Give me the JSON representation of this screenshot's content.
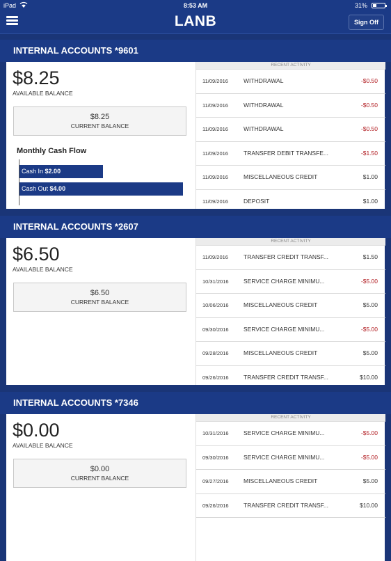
{
  "status": {
    "carrier": "iPad",
    "time": "8:53 AM",
    "battery": "31%"
  },
  "nav": {
    "title": "LANB",
    "sign_off": "Sign Off"
  },
  "recent_activity_label": "RECENT ACTIVITY",
  "accounts": [
    {
      "header": "INTERNAL ACCOUNTS *9601",
      "available_amount": "$8.25",
      "available_label": "AVAILABLE BALANCE",
      "current_amount": "$8.25",
      "current_label": "CURRENT BALANCE",
      "cash_flow": {
        "title": "Monthly Cash Flow",
        "cash_in_label": "Cash In",
        "cash_in_value": "$2.00",
        "cash_out_label": "Cash Out",
        "cash_out_value": "$4.00"
      },
      "transactions": [
        {
          "date": "11/09/2016",
          "desc": "WITHDRAWAL",
          "amount": "-$0.50"
        },
        {
          "date": "11/09/2016",
          "desc": "WITHDRAWAL",
          "amount": "-$0.50"
        },
        {
          "date": "11/09/2016",
          "desc": "WITHDRAWAL",
          "amount": "-$0.50"
        },
        {
          "date": "11/09/2016",
          "desc": "TRANSFER DEBIT TRANSFE...",
          "amount": "-$1.50"
        },
        {
          "date": "11/09/2016",
          "desc": "MISCELLANEOUS CREDIT",
          "amount": "$1.00"
        },
        {
          "date": "11/09/2016",
          "desc": "DEPOSIT",
          "amount": "$1.00"
        }
      ]
    },
    {
      "header": "INTERNAL ACCOUNTS *2607",
      "available_amount": "$6.50",
      "available_label": "AVAILABLE BALANCE",
      "current_amount": "$6.50",
      "current_label": "CURRENT BALANCE",
      "transactions": [
        {
          "date": "11/09/2016",
          "desc": "TRANSFER CREDIT TRANSF...",
          "amount": "$1.50"
        },
        {
          "date": "10/31/2016",
          "desc": "SERVICE CHARGE MINIMU...",
          "amount": "-$5.00"
        },
        {
          "date": "10/06/2016",
          "desc": "MISCELLANEOUS CREDIT",
          "amount": "$5.00"
        },
        {
          "date": "09/30/2016",
          "desc": "SERVICE CHARGE MINIMU...",
          "amount": "-$5.00"
        },
        {
          "date": "09/28/2016",
          "desc": "MISCELLANEOUS CREDIT",
          "amount": "$5.00"
        },
        {
          "date": "09/26/2016",
          "desc": "TRANSFER CREDIT TRANSF...",
          "amount": "$10.00"
        }
      ]
    },
    {
      "header": "INTERNAL ACCOUNTS *7346",
      "available_amount": "$0.00",
      "available_label": "AVAILABLE BALANCE",
      "current_amount": "$0.00",
      "current_label": "CURRENT BALANCE",
      "transactions": [
        {
          "date": "10/31/2016",
          "desc": "SERVICE CHARGE MINIMU...",
          "amount": "-$5.00"
        },
        {
          "date": "09/30/2016",
          "desc": "SERVICE CHARGE MINIMU...",
          "amount": "-$5.00"
        },
        {
          "date": "09/27/2016",
          "desc": "MISCELLANEOUS CREDIT",
          "amount": "$5.00"
        },
        {
          "date": "09/26/2016",
          "desc": "TRANSFER CREDIT TRANSF...",
          "amount": "$10.00"
        }
      ]
    }
  ]
}
